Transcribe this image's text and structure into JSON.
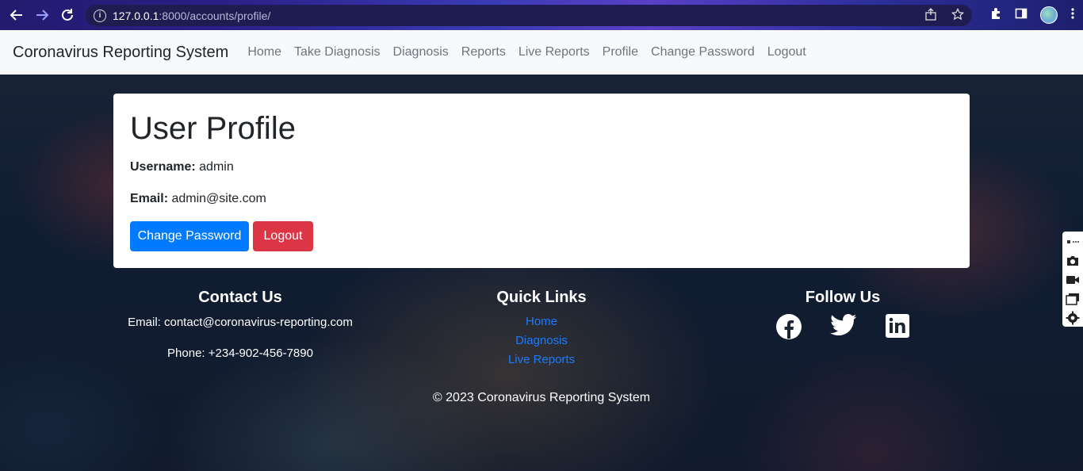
{
  "browser": {
    "url_host": "127.0.0.1",
    "url_rest": ":8000/accounts/profile/"
  },
  "navbar": {
    "brand": "Coronavirus Reporting System",
    "links": [
      "Home",
      "Take Diagnosis",
      "Diagnosis",
      "Reports",
      "Live Reports",
      "Profile",
      "Change Password",
      "Logout"
    ]
  },
  "profile": {
    "title": "User Profile",
    "username_label": "Username:",
    "username_value": "admin",
    "email_label": "Email:",
    "email_value": "admin@site.com",
    "change_password_button": "Change Password",
    "logout_button": "Logout"
  },
  "footer": {
    "contact": {
      "heading": "Contact Us",
      "email": "Email: contact@coronavirus-reporting.com",
      "phone": "Phone: +234-902-456-7890"
    },
    "quick_links": {
      "heading": "Quick Links",
      "links": [
        "Home",
        "Diagnosis",
        "Live Reports"
      ]
    },
    "follow": {
      "heading": "Follow Us",
      "icons": [
        "facebook-icon",
        "twitter-icon",
        "linkedin-icon"
      ]
    },
    "copyright": "© 2023 Coronavirus Reporting System"
  },
  "colors": {
    "primary": "#007bff",
    "danger": "#dc3545",
    "link": "#1b7bff",
    "navbar_bg": "#f8f9fa"
  }
}
